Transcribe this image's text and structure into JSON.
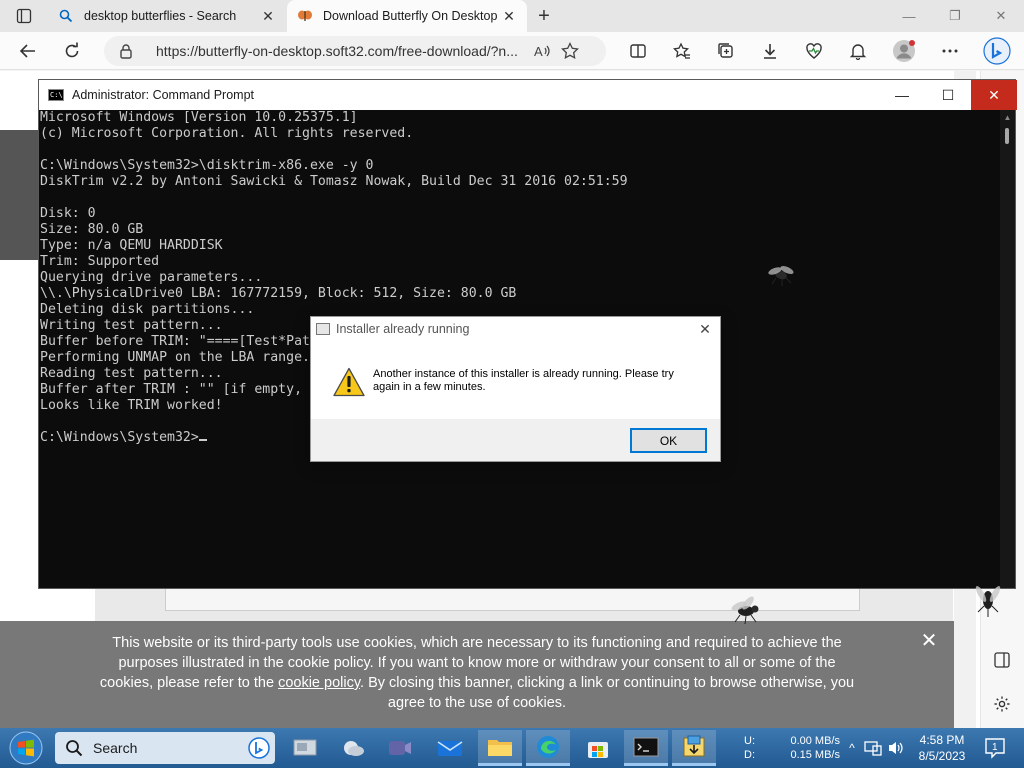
{
  "browser": {
    "tabs": [
      {
        "title": "desktop butterflies - Search",
        "icon": "search-icon"
      },
      {
        "title": "Download Butterfly On Desktop",
        "icon": "butterfly-favicon-icon"
      }
    ],
    "url": "https://butterfly-on-desktop.soft32.com/free-download/?n..."
  },
  "cmd": {
    "title": "Administrator: Command Prompt",
    "lines": [
      "Microsoft Windows [Version 10.0.25375.1]",
      "(c) Microsoft Corporation. All rights reserved.",
      "",
      "C:\\Windows\\System32>\\disktrim-x86.exe -y 0",
      "DiskTrim v2.2 by Antoni Sawicki & Tomasz Nowak, Build Dec 31 2016 02:51:59",
      "",
      "Disk: 0",
      "Size: 80.0 GB",
      "Type: n/a QEMU HARDDISK",
      "Trim: Supported",
      "Querying drive parameters...",
      "\\\\.\\PhysicalDrive0 LBA: 167772159, Block: 512, Size: 80.0 GB",
      "Deleting disk partitions...",
      "Writing test pattern...",
      "Buffer before TRIM: \"====[Test*Pat",
      "Performing UNMAP on the LBA range.",
      "Reading test pattern...",
      "Buffer after TRIM : \"\" [if empty,",
      "Looks like TRIM worked!",
      "",
      "C:\\Windows\\System32>"
    ]
  },
  "dialog": {
    "title": "Installer already running",
    "message": "Another instance of this installer is already running. Please try again in a few minutes.",
    "ok_label": "OK"
  },
  "cookie": {
    "text_before": "This website or its third-party tools use cookies, which are necessary to its functioning and required to achieve the purposes illustrated in the cookie policy. If you want to know more or withdraw your consent to all or some of the cookies, please refer to the ",
    "link": "cookie policy",
    "text_after": ". By closing this banner, clicking a link or continuing to browse otherwise, you agree to the use of cookies."
  },
  "taskbar": {
    "search_label": "Search",
    "net": {
      "up_label": "U:",
      "up_value": "0.00 MB/s",
      "down_label": "D:",
      "down_value": "0.15 MB/s"
    },
    "time": "4:58 PM",
    "date": "8/5/2023",
    "notification_count": "1"
  },
  "colors": {
    "cmd_close": "#c42b1c",
    "taskbar": "#225a92",
    "cmd_bg": "#0c0c0c"
  }
}
